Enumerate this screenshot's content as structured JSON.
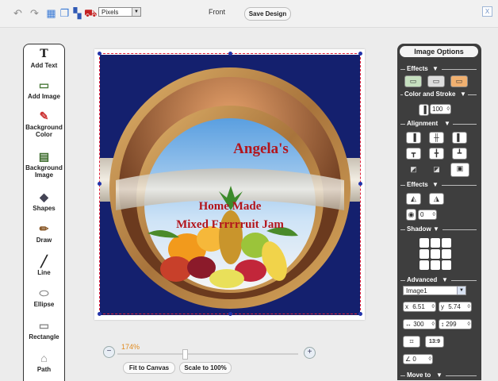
{
  "toolbar": {
    "icons": [
      "undo-icon",
      "redo-icon",
      "grid-icon",
      "layers-icon",
      "delete-icon",
      "preview-icon"
    ],
    "units_value": "Pixels",
    "side_label": "Front",
    "save_label": "Save Design",
    "close_label": "X"
  },
  "tools": [
    {
      "label": "Add Text",
      "icon": "T"
    },
    {
      "label": "Add Image",
      "icon": "▭"
    },
    {
      "label": "Background Color",
      "icon": "✎"
    },
    {
      "label": "Background Image",
      "icon": "▤"
    },
    {
      "label": "Shapes",
      "icon": "◆"
    },
    {
      "label": "Draw",
      "icon": "✏"
    },
    {
      "label": "Line",
      "icon": "╱"
    },
    {
      "label": "Ellipse",
      "icon": "⬭"
    },
    {
      "label": "Rectangle",
      "icon": "▭"
    },
    {
      "label": "Path",
      "icon": "⌂"
    }
  ],
  "design": {
    "title": "Angela's",
    "line1": "Home     Made",
    "line2": "Mixed Frrrrruit Jam",
    "colors": {
      "background": "#14206e",
      "text": "#b3151c",
      "ring": "#b48a4a"
    }
  },
  "zoom": {
    "percent": "174%",
    "minus": "−",
    "plus": "+",
    "fit_label": "Fit to Canvas",
    "scale_label": "Scale to 100%"
  },
  "panel": {
    "title": "Image Options",
    "sections": {
      "effects": "Effects",
      "color_stroke": "Color and Stroke",
      "alignment": "Alignment",
      "effects2": "Effects",
      "shadow": "Shadow",
      "advanced": "Advanced",
      "move_to": "Move to"
    },
    "opacity": "100",
    "rotate": "0",
    "layer_select": "Image1",
    "x_label": "x",
    "x_value": "6.51",
    "y_label": "y",
    "y_value": "5.74",
    "width_value": "300",
    "height_value": "299",
    "ratio_label": "13:9",
    "angle_value": "0"
  }
}
